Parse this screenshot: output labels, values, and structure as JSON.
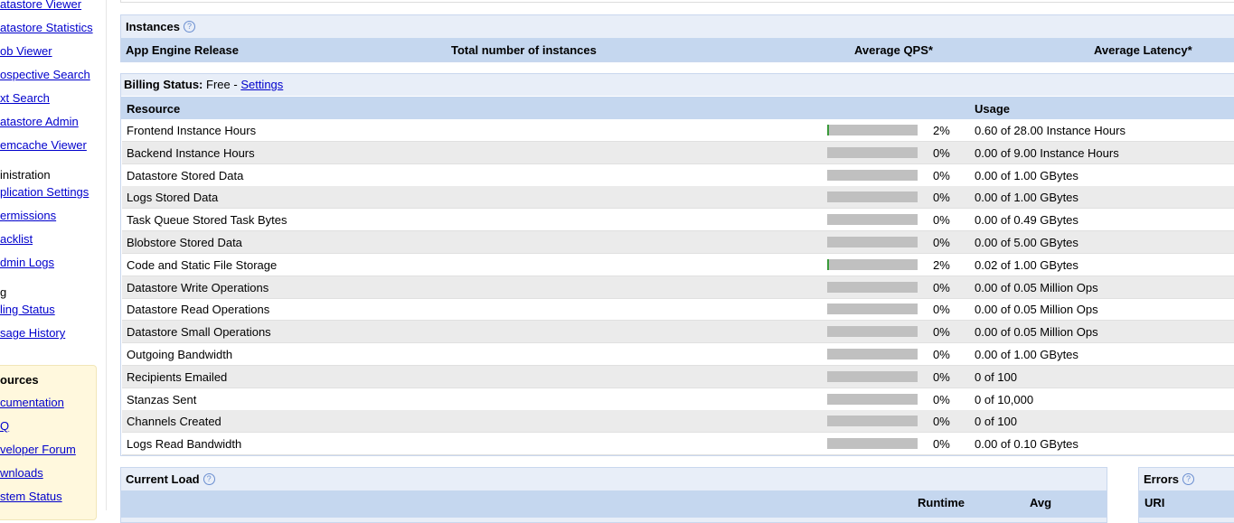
{
  "sidebar": {
    "links": [
      "atastore Viewer",
      "atastore Statistics",
      "ob Viewer",
      "ospective Search",
      "xt Search",
      "atastore Admin",
      "emcache Viewer"
    ],
    "admin_heading": "inistration",
    "admin_links": [
      "plication Settings",
      "ermissions",
      "acklist",
      "dmin Logs"
    ],
    "billing_heading": "g",
    "billing_links": [
      "ling Status",
      "sage History"
    ],
    "resources_heading": "ources",
    "resources_links": [
      "cumentation",
      "Q",
      "veloper Forum",
      "wnloads",
      "stem Status"
    ]
  },
  "instances": {
    "title": "Instances",
    "columns": [
      "App Engine Release",
      "Total number of instances",
      "Average QPS*",
      "Average Latency*"
    ]
  },
  "billing": {
    "label": "Billing Status:",
    "value": "Free -",
    "settings_link": "Settings",
    "columns": {
      "resource": "Resource",
      "usage": "Usage"
    },
    "rows": [
      {
        "resource": "Frontend Instance Hours",
        "percent": 2,
        "pct_label": "2%",
        "usage": "0.60 of 28.00 Instance Hours"
      },
      {
        "resource": "Backend Instance Hours",
        "percent": 0,
        "pct_label": "0%",
        "usage": "0.00 of 9.00 Instance Hours"
      },
      {
        "resource": "Datastore Stored Data",
        "percent": 0,
        "pct_label": "0%",
        "usage": "0.00 of 1.00 GBytes"
      },
      {
        "resource": "Logs Stored Data",
        "percent": 0,
        "pct_label": "0%",
        "usage": "0.00 of 1.00 GBytes"
      },
      {
        "resource": "Task Queue Stored Task Bytes",
        "percent": 0,
        "pct_label": "0%",
        "usage": "0.00 of 0.49 GBytes"
      },
      {
        "resource": "Blobstore Stored Data",
        "percent": 0,
        "pct_label": "0%",
        "usage": "0.00 of 5.00 GBytes"
      },
      {
        "resource": "Code and Static File Storage",
        "percent": 2,
        "pct_label": "2%",
        "usage": "0.02 of 1.00 GBytes"
      },
      {
        "resource": "Datastore Write Operations",
        "percent": 0,
        "pct_label": "0%",
        "usage": "0.00 of 0.05 Million Ops"
      },
      {
        "resource": "Datastore Read Operations",
        "percent": 0,
        "pct_label": "0%",
        "usage": "0.00 of 0.05 Million Ops"
      },
      {
        "resource": "Datastore Small Operations",
        "percent": 0,
        "pct_label": "0%",
        "usage": "0.00 of 0.05 Million Ops"
      },
      {
        "resource": "Outgoing Bandwidth",
        "percent": 0,
        "pct_label": "0%",
        "usage": "0.00 of 1.00 GBytes"
      },
      {
        "resource": "Recipients Emailed",
        "percent": 0,
        "pct_label": "0%",
        "usage": "0 of 100"
      },
      {
        "resource": "Stanzas Sent",
        "percent": 0,
        "pct_label": "0%",
        "usage": "0 of 10,000"
      },
      {
        "resource": "Channels Created",
        "percent": 0,
        "pct_label": "0%",
        "usage": "0 of 100"
      },
      {
        "resource": "Logs Read Bandwidth",
        "percent": 0,
        "pct_label": "0%",
        "usage": "0.00 of 0.10 GBytes"
      }
    ]
  },
  "current_load": {
    "title": "Current Load",
    "columns": [
      "Runtime",
      "Avg"
    ]
  },
  "errors": {
    "title": "Errors",
    "columns": [
      "URI"
    ]
  },
  "colors": {
    "bar_fill": "#3a9a3a",
    "bar_track": "#c0c0c0",
    "header_bg": "#c5d7ef"
  }
}
